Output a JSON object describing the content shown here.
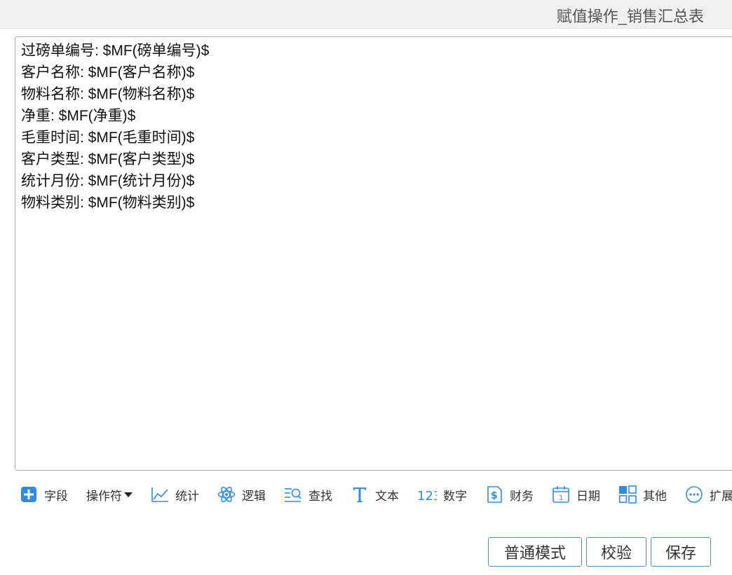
{
  "window": {
    "title": "赋值操作_销售汇总表"
  },
  "editor": {
    "lines": [
      "过磅单编号: $MF(磅单编号)$",
      "客户名称: $MF(客户名称)$",
      "物料名称: $MF(物料名称)$",
      "净重: $MF(净重)$",
      "毛重时间: $MF(毛重时间)$",
      "客户类型: $MF(客户类型)$",
      "统计月份: $MF(统计月份)$",
      "物料类别: $MF(物料类别)$"
    ]
  },
  "toolbar": {
    "items": [
      {
        "label": "字段",
        "icon": "plus-square-icon"
      },
      {
        "label": "操作符",
        "icon": "caret-down-icon"
      },
      {
        "label": "统计",
        "icon": "line-chart-icon"
      },
      {
        "label": "逻辑",
        "icon": "atom-icon"
      },
      {
        "label": "查找",
        "icon": "search-list-icon"
      },
      {
        "label": "文本",
        "icon": "text-t-icon"
      },
      {
        "label": "数字",
        "icon": "number-123-icon"
      },
      {
        "label": "财务",
        "icon": "dollar-doc-icon"
      },
      {
        "label": "日期",
        "icon": "calendar-icon"
      },
      {
        "label": "其他",
        "icon": "grid-icon"
      },
      {
        "label": "扩展",
        "icon": "ellipsis-circle-icon"
      }
    ]
  },
  "buttons": {
    "normal_mode": "普通模式",
    "validate": "校验",
    "save": "保存"
  },
  "colors": {
    "accent": "#2f8be6",
    "button_border": "#4b8ec9",
    "titlebar_bg": "#f0f0f0"
  }
}
